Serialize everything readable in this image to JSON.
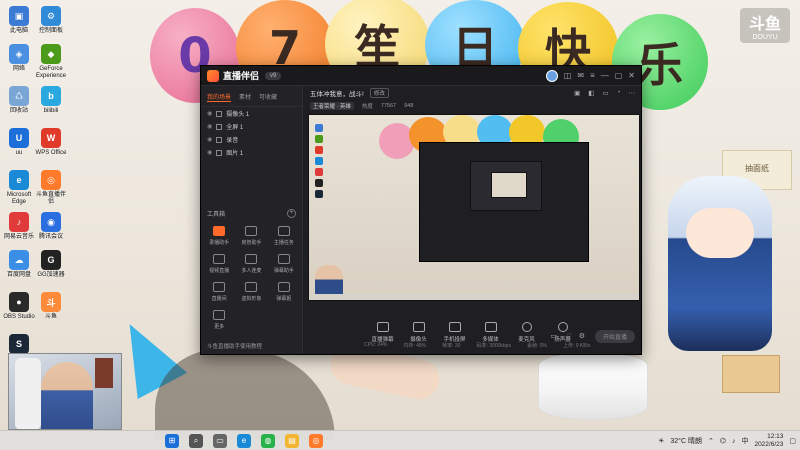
{
  "wallpaper": {
    "balloon_text": [
      "0",
      "7",
      "笙",
      "日",
      "快",
      "乐"
    ],
    "brand": "斗鱼",
    "brand_sub": "DOUYU",
    "box_label": "抽面纸"
  },
  "desktop_icons": [
    {
      "label": "此电脑",
      "color": "#3b7bd4",
      "glyph": "▣"
    },
    {
      "label": "控制面板",
      "color": "#2f8ad8",
      "glyph": "⚙"
    },
    {
      "label": "网络",
      "color": "#4a8fe0",
      "glyph": "◈"
    },
    {
      "label": "GeForce Experience",
      "color": "#4b9a1a",
      "glyph": "◆"
    },
    {
      "label": "回收站",
      "color": "#7aa6d6",
      "glyph": "♺"
    },
    {
      "label": "bilibili",
      "color": "#2aa9e0",
      "glyph": "b"
    },
    {
      "label": "uu",
      "color": "#1c6fd8",
      "glyph": "U"
    },
    {
      "label": "WPS Office",
      "color": "#e03a2a",
      "glyph": "W"
    },
    {
      "label": "Microsoft Edge",
      "color": "#1a8ad6",
      "glyph": "e"
    },
    {
      "label": "斗鱼直播伴侣",
      "color": "#ff7a2a",
      "glyph": "◎"
    },
    {
      "label": "腾讯会议",
      "color": "#2a6fe0",
      "glyph": "◉"
    },
    {
      "label": "网易云音乐",
      "color": "#e03a3a",
      "glyph": "♪"
    },
    {
      "label": "GG加速器",
      "color": "#222222",
      "glyph": "G"
    },
    {
      "label": "百度网盘",
      "color": "#3a8ee6",
      "glyph": "☁"
    },
    {
      "label": "OBS Studio",
      "color": "#2a2a2a",
      "glyph": "●"
    },
    {
      "label": "斗鱼",
      "color": "#ff8a3a",
      "glyph": "斗"
    },
    {
      "label": "Steam",
      "color": "#1b2838",
      "glyph": "S"
    }
  ],
  "app": {
    "name": "直播伴侣",
    "version": "v9",
    "side_tabs": [
      "我的场景",
      "素材",
      "可收藏"
    ],
    "scenes": [
      "摄像头 1",
      "全屏 1",
      "录音",
      "图片 1"
    ],
    "tools_title": "工具箱",
    "tools": [
      {
        "label": "录播助手",
        "hot": true
      },
      {
        "label": "房管助手",
        "hot": false
      },
      {
        "label": "主播任务",
        "hot": false
      },
      {
        "label": "视频直播",
        "hot": false
      },
      {
        "label": "多人连麦",
        "hot": false
      },
      {
        "label": "弹幕助手",
        "hot": false
      },
      {
        "label": "直播间",
        "hot": false
      },
      {
        "label": "虚拟形象",
        "hot": false
      },
      {
        "label": "弹幕姬",
        "hot": false
      },
      {
        "label": "更多",
        "hot": false
      }
    ],
    "side_footer": "斗鱼直播助手使用教程",
    "room_title": "五体冲我意，战斗!",
    "modify": "修改",
    "category": "王者荣耀 · 英雄",
    "viewers_label": "热度",
    "viewers": "77567",
    "fans": "948",
    "controls": [
      "直播弹幕",
      "摄像头",
      "手机投屏",
      "多媒体",
      "麦克风",
      "扬声器"
    ],
    "go_live": "开始直播",
    "stats": [
      "CPU: 24%",
      "内存: 48%",
      "帧率: 30",
      "码率: 3000kbps",
      "丢帧: 0%",
      "上传: 0 KB/s"
    ]
  },
  "taskbar": {
    "apps": [
      {
        "name": "start",
        "color": "#1b6fd8",
        "glyph": "⊞"
      },
      {
        "name": "search",
        "color": "#555555",
        "glyph": "⌕"
      },
      {
        "name": "task-view",
        "color": "#666666",
        "glyph": "▭"
      },
      {
        "name": "edge",
        "color": "#1a8ad6",
        "glyph": "e"
      },
      {
        "name": "wechat",
        "color": "#29b14a",
        "glyph": "◍"
      },
      {
        "name": "explorer",
        "color": "#f2b632",
        "glyph": "▤"
      },
      {
        "name": "douyu",
        "color": "#ff7a2a",
        "glyph": "◎"
      }
    ],
    "weather": "32°C 晴朗",
    "time": "12:13",
    "date": "2022/6/23"
  }
}
